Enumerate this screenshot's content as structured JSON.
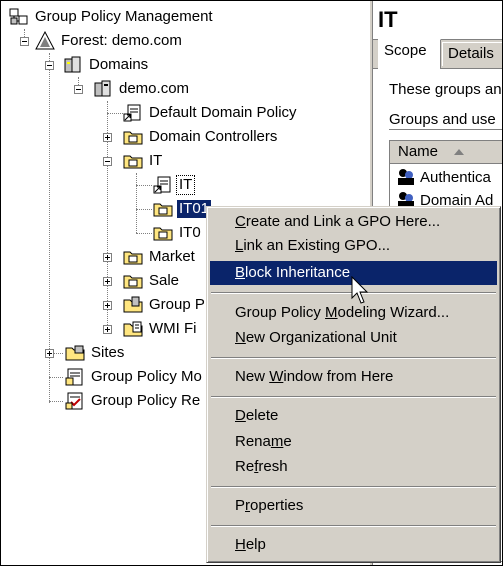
{
  "tree": {
    "root": "Group Policy Management",
    "forest": "Forest: demo.com",
    "domains": "Domains",
    "domain": "demo.com",
    "default_policy": "Default Domain Policy",
    "domain_controllers": "Domain Controllers",
    "it": "IT",
    "it_gpo": "IT",
    "it01": "IT01",
    "it0x": "IT0",
    "marketing": "Market",
    "sale": "Sale",
    "group_policy_objects": "Group P",
    "wmi_filters": "WMI Fi",
    "sites": "Sites",
    "modeling": "Group Policy Mo",
    "results": "Group Policy Re"
  },
  "details": {
    "title": "IT",
    "tabs": [
      "Scope",
      "Details"
    ],
    "text_line1": "These groups an",
    "text_line2": "Groups and use",
    "column_name": "Name",
    "rows": [
      "Authentica",
      "Domain Ad"
    ]
  },
  "context_menu": {
    "items": [
      {
        "pre": "",
        "key": "C",
        "post": "reate and Link a GPO Here..."
      },
      {
        "pre": "",
        "key": "L",
        "post": "ink an Existing GPO..."
      },
      {
        "pre": "",
        "key": "B",
        "post": "lock Inheritance"
      },
      {
        "pre": "Group Policy ",
        "key": "M",
        "post": "odeling Wizard..."
      },
      {
        "pre": "",
        "key": "N",
        "post": "ew Organizational Unit"
      },
      {
        "pre": "New ",
        "key": "W",
        "post": "indow from Here"
      },
      {
        "pre": "",
        "key": "D",
        "post": "elete"
      },
      {
        "pre": "Rena",
        "key": "m",
        "post": "e"
      },
      {
        "pre": "Re",
        "key": "f",
        "post": "resh"
      },
      {
        "pre": "P",
        "key": "r",
        "post": "operties"
      },
      {
        "pre": "",
        "key": "H",
        "post": "elp"
      }
    ],
    "highlighted": "Block Inheritance"
  },
  "colors": {
    "selection": "#0a246a",
    "face": "#d4d0c8",
    "shadow": "#808080"
  }
}
